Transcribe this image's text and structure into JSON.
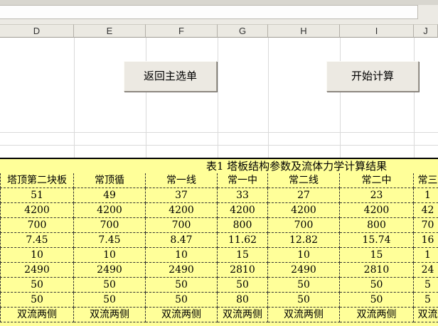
{
  "columns": [
    "D",
    "E",
    "F",
    "G",
    "H",
    "I",
    "J"
  ],
  "buttons": {
    "back": "返回主选单",
    "start": "开始计算"
  },
  "table": {
    "title": "表1 塔板结构参数及流体力学计算结果",
    "headers": [
      "塔顶第二块板",
      "常顶循",
      "常一线",
      "常一中",
      "常二线",
      "常二中",
      "常三"
    ],
    "rows": [
      [
        "51",
        "49",
        "37",
        "33",
        "27",
        "23",
        "1"
      ],
      [
        "4200",
        "4200",
        "4200",
        "4200",
        "4200",
        "4200",
        "42"
      ],
      [
        "700",
        "700",
        "700",
        "800",
        "700",
        "800",
        "70"
      ],
      [
        "7.45",
        "7.45",
        "8.47",
        "11.62",
        "12.82",
        "15.74",
        "16"
      ],
      [
        "10",
        "10",
        "10",
        "15",
        "10",
        "15",
        "1"
      ],
      [
        "2490",
        "2490",
        "2490",
        "2810",
        "2490",
        "2810",
        "24"
      ],
      [
        "50",
        "50",
        "50",
        "50",
        "50",
        "50",
        "5"
      ],
      [
        "50",
        "50",
        "50",
        "80",
        "50",
        "50",
        "5"
      ],
      [
        "双流两侧",
        "双流两侧",
        "双流两侧",
        "双流两侧",
        "双流两侧",
        "双流两侧",
        "双流"
      ]
    ]
  },
  "colors": {
    "table_bg": "#ffff99",
    "header_bg": "#ebe9e2",
    "button_bg": "#ece9e2"
  }
}
